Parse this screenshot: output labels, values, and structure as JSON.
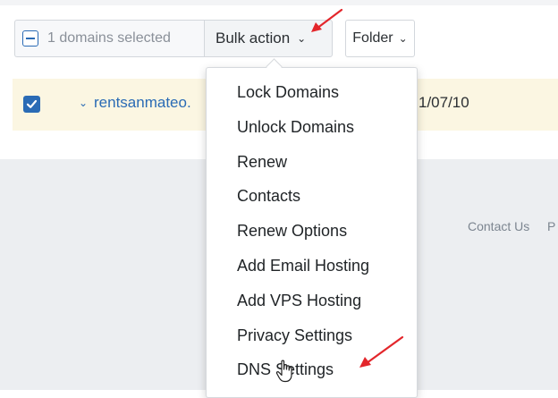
{
  "toolbar": {
    "selection_text": "1 domains selected",
    "bulk_action_label": "Bulk action",
    "folder_label": "Folder"
  },
  "row": {
    "domain": "rentsanmateo.",
    "date": "1/07/10"
  },
  "menu": {
    "items": [
      "Lock Domains",
      "Unlock Domains",
      "Renew",
      "Contacts",
      "Renew Options",
      "Add Email Hosting",
      "Add VPS Hosting",
      "Privacy Settings",
      "DNS Settings"
    ]
  },
  "footer": {
    "contact_label": "Contact Us",
    "next_label": "P"
  },
  "colors": {
    "accent": "#2a6bb5",
    "row_highlight": "#fbf6e2",
    "annotation_arrow": "#e3262b"
  },
  "icons": {
    "dropdown": "chevron-down-icon",
    "checked": "checkbox-checked-icon",
    "partial": "checkbox-indeterminate-icon",
    "pointer": "hand-pointer-cursor-icon"
  }
}
